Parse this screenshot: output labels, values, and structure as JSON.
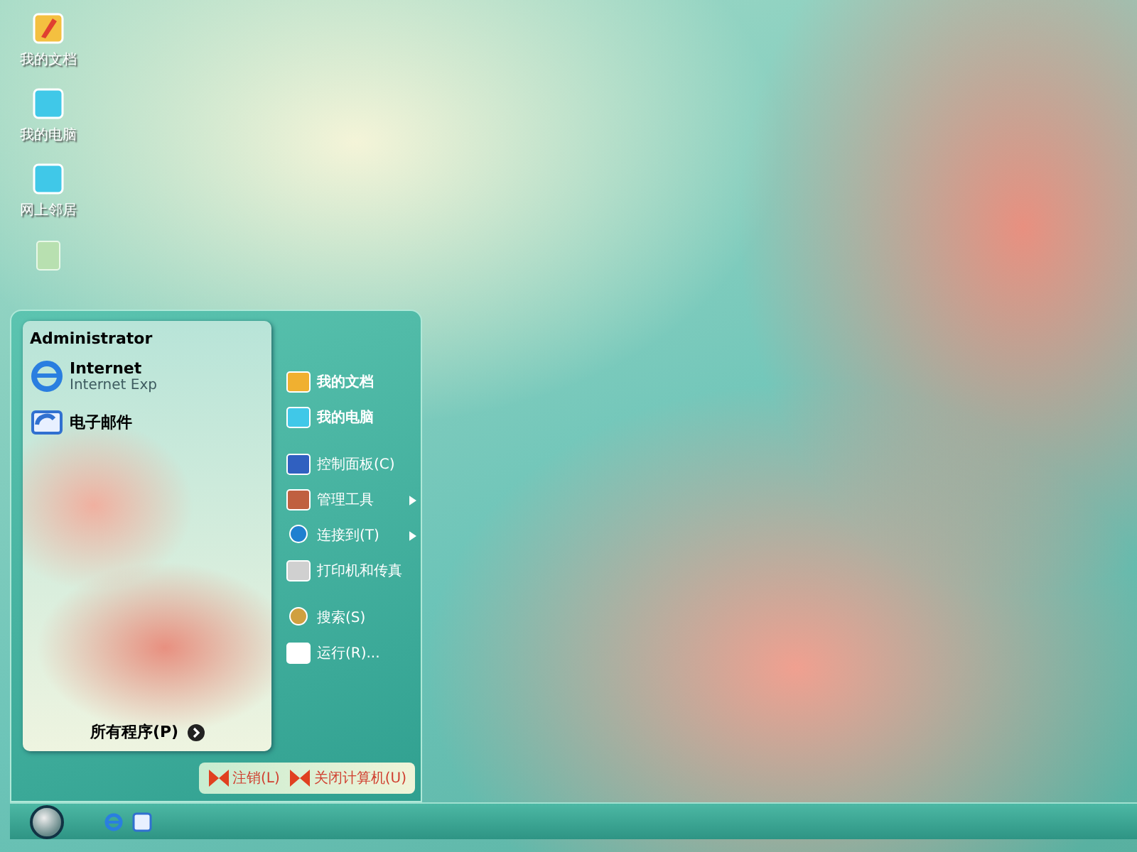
{
  "desktop_icons": [
    {
      "label": "我的文档"
    },
    {
      "label": "我的电脑"
    },
    {
      "label": "网上邻居"
    }
  ],
  "start_menu": {
    "user": "Administrator",
    "pinned": [
      {
        "title": "Internet",
        "subtitle": "Internet Exp"
      },
      {
        "title": "电子邮件"
      }
    ],
    "all_programs": "所有程序(P)",
    "places": [
      {
        "label": "我的文档",
        "kind": "bold",
        "has_submenu": false
      },
      {
        "label": "我的电脑",
        "kind": "bold",
        "has_submenu": false
      },
      {
        "label": "控制面板(C)",
        "kind": "normal",
        "has_submenu": false
      },
      {
        "label": "管理工具",
        "kind": "normal",
        "has_submenu": true
      },
      {
        "label": "连接到(T)",
        "kind": "normal",
        "has_submenu": true
      },
      {
        "label": "打印机和传真",
        "kind": "normal",
        "has_submenu": false
      },
      {
        "label": "搜索(S)",
        "kind": "normal",
        "has_submenu": false
      },
      {
        "label": "运行(R)...",
        "kind": "normal",
        "has_submenu": false
      }
    ],
    "logoff": "注销(L)",
    "shutdown": "关闭计算机(U)"
  }
}
